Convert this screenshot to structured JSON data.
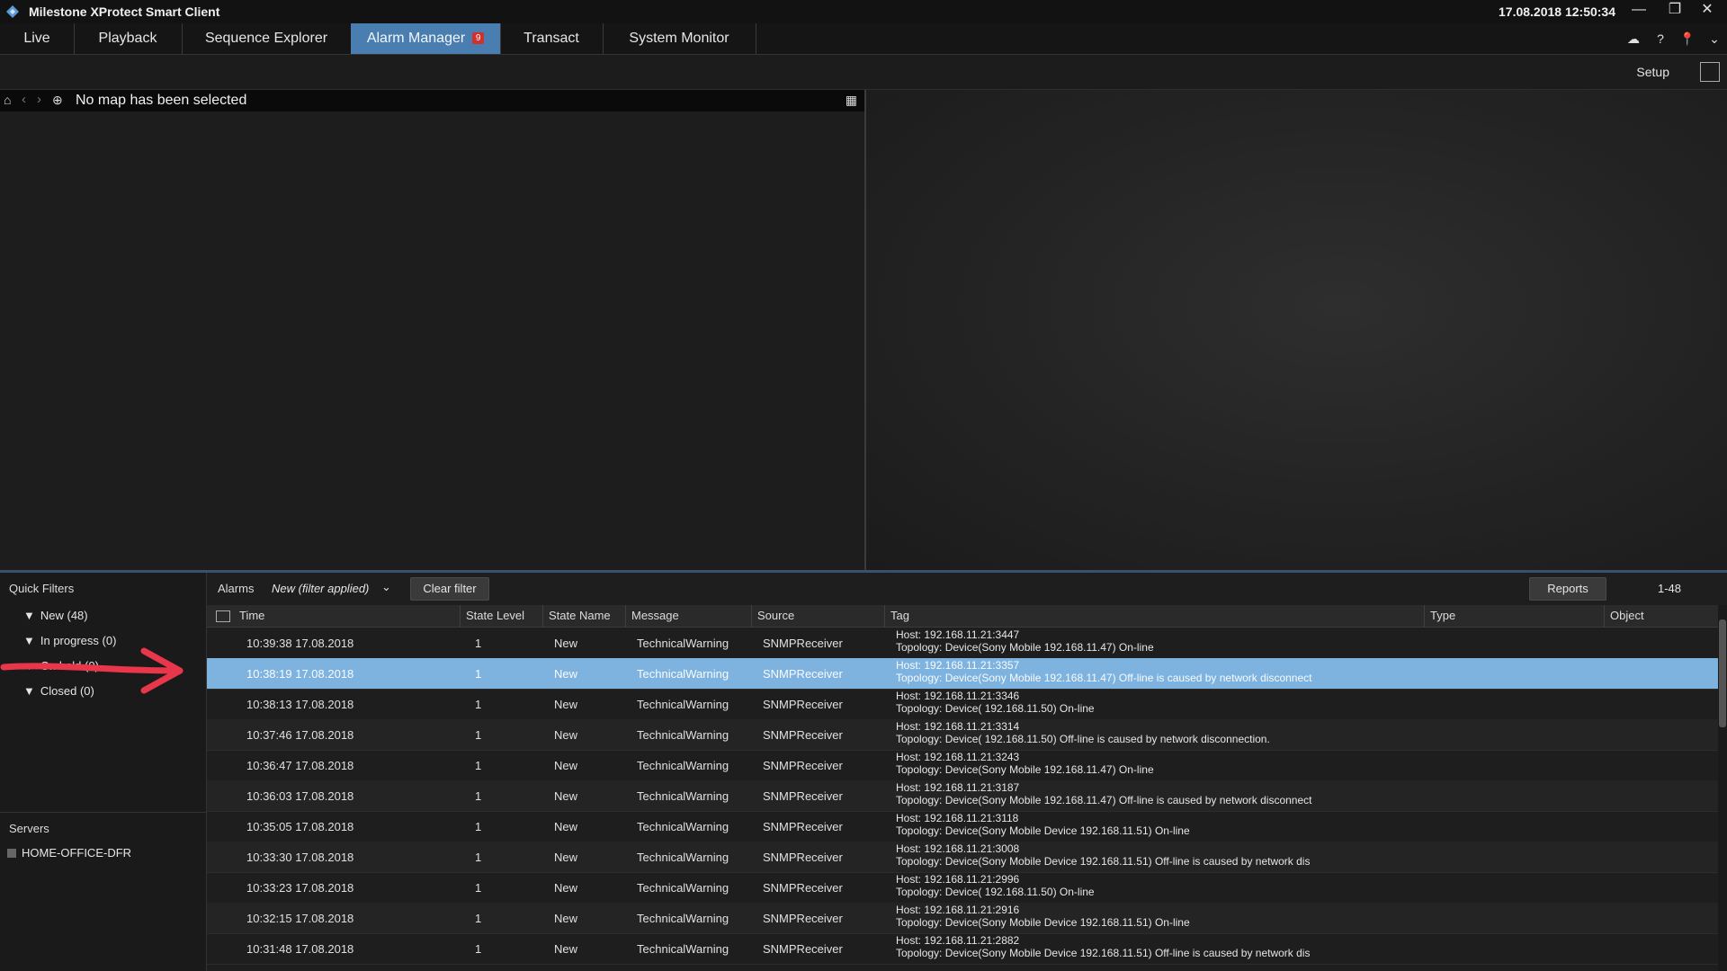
{
  "app": {
    "title": "Milestone XProtect Smart Client",
    "datetime": "17.08.2018 12:50:34"
  },
  "window_controls": {
    "minimize": "—",
    "restore": "❐",
    "close": "✕"
  },
  "tabs": [
    {
      "label": "Live"
    },
    {
      "label": "Playback"
    },
    {
      "label": "Sequence Explorer"
    },
    {
      "label": "Alarm Manager",
      "active": true,
      "badge": "9"
    },
    {
      "label": "Transact"
    },
    {
      "label": "System Monitor"
    }
  ],
  "toolbar_icons": [
    "cloud-icon",
    "help-icon",
    "pin-icon",
    "chevron-down-icon"
  ],
  "setup": {
    "label": "Setup"
  },
  "map": {
    "title": "No map has been selected"
  },
  "quick_filters": {
    "title": "Quick Filters",
    "items": [
      {
        "label": "New (48)"
      },
      {
        "label": "In progress (0)"
      },
      {
        "label": "On hold (0)"
      },
      {
        "label": "Closed (0)"
      }
    ]
  },
  "servers": {
    "title": "Servers",
    "items": [
      {
        "label": "HOME-OFFICE-DFR"
      }
    ]
  },
  "alarms": {
    "label": "Alarms",
    "filter_value": "New (filter applied)",
    "clear_filter": "Clear filter",
    "reports": "Reports",
    "range": "1-48",
    "columns": [
      "Time",
      "State Level",
      "State Name",
      "Message",
      "Source",
      "Tag",
      "Type",
      "Object"
    ],
    "rows": [
      {
        "time": "10:39:38 17.08.2018",
        "level": "1",
        "state": "New",
        "message": "TechnicalWarning",
        "source": "SNMPReceiver",
        "tag_host": "Host: 192.168.11.21:3447",
        "tag_topology": "Topology: Device(Sony Mobile 192.168.11.47) On-line"
      },
      {
        "time": "10:38:19 17.08.2018",
        "level": "1",
        "state": "New",
        "message": "TechnicalWarning",
        "source": "SNMPReceiver",
        "tag_host": "Host: 192.168.11.21:3357",
        "tag_topology": "Topology: Device(Sony Mobile 192.168.11.47) Off-line is caused by network disconnect",
        "selected": true
      },
      {
        "time": "10:38:13 17.08.2018",
        "level": "1",
        "state": "New",
        "message": "TechnicalWarning",
        "source": "SNMPReceiver",
        "tag_host": "Host: 192.168.11.21:3346",
        "tag_topology": "Topology: Device( 192.168.11.50) On-line"
      },
      {
        "time": "10:37:46 17.08.2018",
        "level": "1",
        "state": "New",
        "message": "TechnicalWarning",
        "source": "SNMPReceiver",
        "tag_host": "Host: 192.168.11.21:3314",
        "tag_topology": "Topology: Device( 192.168.11.50) Off-line is caused by network disconnection."
      },
      {
        "time": "10:36:47 17.08.2018",
        "level": "1",
        "state": "New",
        "message": "TechnicalWarning",
        "source": "SNMPReceiver",
        "tag_host": "Host: 192.168.11.21:3243",
        "tag_topology": "Topology: Device(Sony Mobile 192.168.11.47) On-line"
      },
      {
        "time": "10:36:03 17.08.2018",
        "level": "1",
        "state": "New",
        "message": "TechnicalWarning",
        "source": "SNMPReceiver",
        "tag_host": "Host: 192.168.11.21:3187",
        "tag_topology": "Topology: Device(Sony Mobile 192.168.11.47) Off-line is caused by network disconnect"
      },
      {
        "time": "10:35:05 17.08.2018",
        "level": "1",
        "state": "New",
        "message": "TechnicalWarning",
        "source": "SNMPReceiver",
        "tag_host": "Host: 192.168.11.21:3118",
        "tag_topology": "Topology: Device(Sony Mobile Device 192.168.11.51) On-line"
      },
      {
        "time": "10:33:30 17.08.2018",
        "level": "1",
        "state": "New",
        "message": "TechnicalWarning",
        "source": "SNMPReceiver",
        "tag_host": "Host: 192.168.11.21:3008",
        "tag_topology": "Topology: Device(Sony Mobile Device 192.168.11.51) Off-line is caused by network dis"
      },
      {
        "time": "10:33:23 17.08.2018",
        "level": "1",
        "state": "New",
        "message": "TechnicalWarning",
        "source": "SNMPReceiver",
        "tag_host": "Host: 192.168.11.21:2996",
        "tag_topology": "Topology: Device( 192.168.11.50) On-line"
      },
      {
        "time": "10:32:15 17.08.2018",
        "level": "1",
        "state": "New",
        "message": "TechnicalWarning",
        "source": "SNMPReceiver",
        "tag_host": "Host: 192.168.11.21:2916",
        "tag_topology": "Topology: Device(Sony Mobile Device 192.168.11.51) On-line"
      },
      {
        "time": "10:31:48 17.08.2018",
        "level": "1",
        "state": "New",
        "message": "TechnicalWarning",
        "source": "SNMPReceiver",
        "tag_host": "Host: 192.168.11.21:2882",
        "tag_topology": "Topology: Device(Sony Mobile Device 192.168.11.51) Off-line is caused by network dis"
      }
    ]
  },
  "colors": {
    "accent": "#4a7eb0",
    "selected_row": "#7eb3df",
    "annotation_arrow": "#e8374a",
    "badge": "#d0312d"
  }
}
